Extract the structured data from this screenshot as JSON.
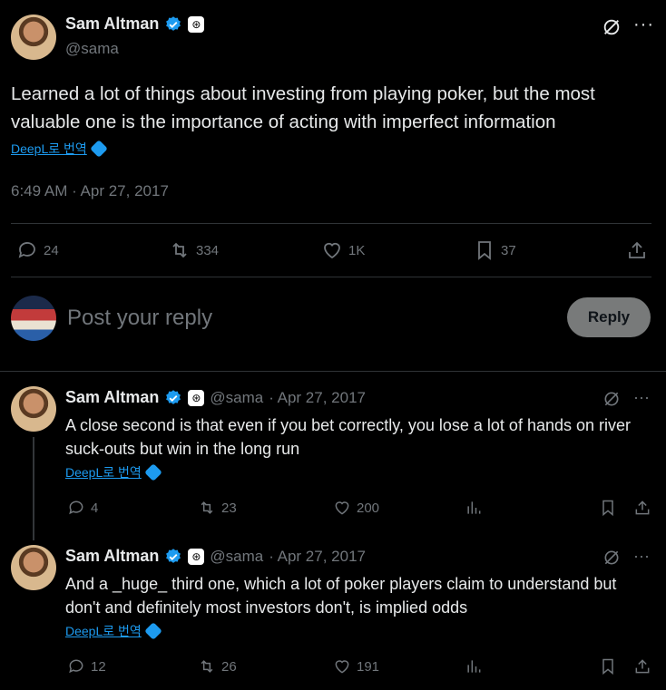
{
  "main_post": {
    "name": "Sam Altman",
    "handle": "@sama",
    "text": "Learned a lot of things about investing from playing poker, but the most valuable one is the importance of acting with imperfect information",
    "translate": "DeepL로 번역",
    "timestamp": "6:49 AM · Apr 27, 2017",
    "stats": {
      "replies": "24",
      "reposts": "334",
      "likes": "1K",
      "bookmarks": "37"
    }
  },
  "composer": {
    "placeholder": "Post your reply",
    "button": "Reply"
  },
  "replies": [
    {
      "name": "Sam Altman",
      "handle": "@sama",
      "date": "· Apr 27, 2017",
      "text": "A close second is that even if you bet correctly, you lose a lot of hands on river suck-outs but win in the long run",
      "translate": "DeepL로 번역",
      "stats": {
        "replies": "4",
        "reposts": "23",
        "likes": "200"
      }
    },
    {
      "name": "Sam Altman",
      "handle": "@sama",
      "date": "· Apr 27, 2017",
      "text": "And a _huge_ third one, which a lot of poker players claim to understand but don't and definitely most investors don't, is implied odds",
      "translate": "DeepL로 번역",
      "stats": {
        "replies": "12",
        "reposts": "26",
        "likes": "191"
      }
    }
  ],
  "colors": {
    "accent": "#1d9bf0",
    "background": "#000000",
    "text": "#e7e9ea",
    "muted": "#71767b"
  }
}
